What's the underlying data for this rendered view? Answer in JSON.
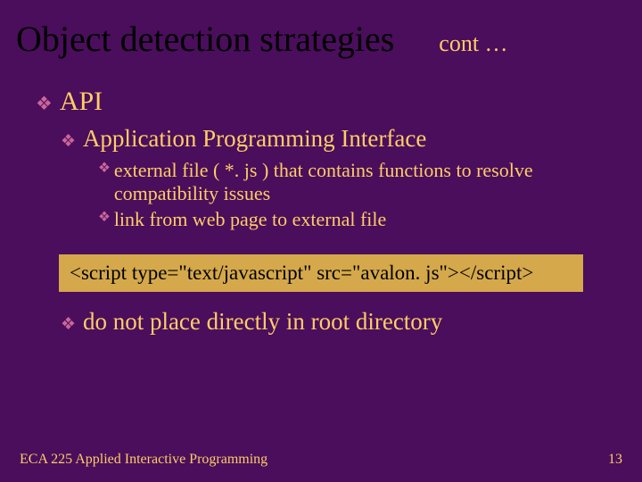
{
  "title": "Object detection strategies",
  "cont": "cont …",
  "b1": "API",
  "b2": "Application Programming Interface",
  "b3a": "external file ( *. js ) that contains functions to resolve compatibility issues",
  "b3b": "link from web page to external file",
  "code": "<script type=\"text/javascript\" src=\"avalon. js\"></script>",
  "b2b": "do not place directly in root directory",
  "footer_left": "ECA 225   Applied Interactive Programming",
  "footer_right": "13"
}
